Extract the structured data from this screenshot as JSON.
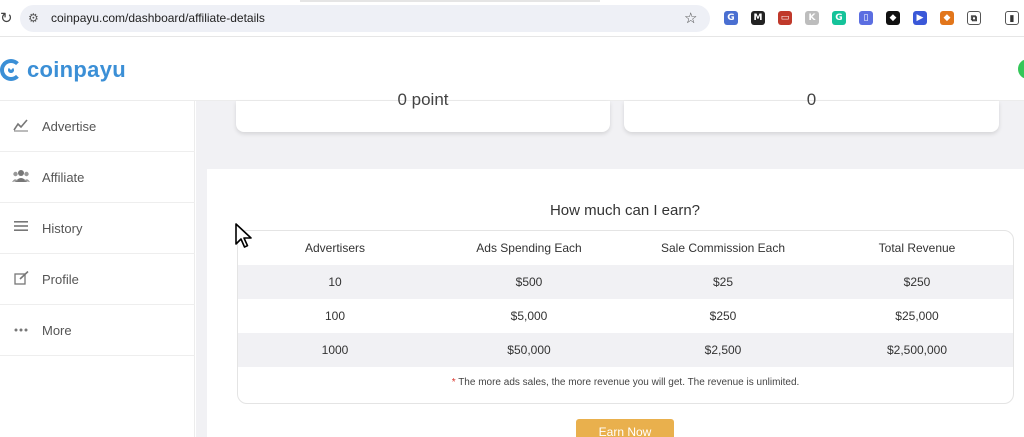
{
  "browser": {
    "url": "coinpayu.com/dashboard/affiliate-details",
    "extensions": [
      {
        "name": "translate-icon",
        "color": "#4a6fd1",
        "glyph": "G"
      },
      {
        "name": "m-extension-icon",
        "color": "#222222",
        "glyph": "M"
      },
      {
        "name": "inbox-extension-icon",
        "color": "#c0392b",
        "glyph": "▭"
      },
      {
        "name": "k-extension-icon",
        "color": "#bdbdbd",
        "glyph": "K"
      },
      {
        "name": "grammarly-icon",
        "color": "#15c39a",
        "glyph": "G"
      },
      {
        "name": "screen-extension-icon",
        "color": "#5b6ee1",
        "glyph": "▯"
      },
      {
        "name": "drop-extension-icon",
        "color": "#111111",
        "glyph": "◆"
      },
      {
        "name": "play-extension-icon",
        "color": "#3a58d8",
        "glyph": "▶"
      },
      {
        "name": "metamask-icon",
        "color": "#e2761b",
        "glyph": "◆"
      },
      {
        "name": "extensions-puzzle-icon",
        "color": "#ffffff",
        "glyph": "⧉"
      },
      {
        "name": "side-panel-icon",
        "color": "#ffffff",
        "glyph": "▮"
      }
    ]
  },
  "header": {
    "logo_text": "coinpayu",
    "brand_color": "#3b8fd6"
  },
  "sidebar": {
    "items": [
      {
        "label": "Advertise",
        "icon": "chart-line-icon"
      },
      {
        "label": "Affiliate",
        "icon": "users-icon"
      },
      {
        "label": "History",
        "icon": "list-icon"
      },
      {
        "label": "Profile",
        "icon": "edit-icon"
      },
      {
        "label": "More",
        "icon": "ellipsis-icon"
      }
    ]
  },
  "stats": {
    "left_value": "0 point",
    "right_value": "0"
  },
  "earnings": {
    "title": "How much can I earn?",
    "headers": [
      "Advertisers",
      "Ads Spending Each",
      "Sale Commission Each",
      "Total Revenue"
    ],
    "rows": [
      [
        "10",
        "$500",
        "$25",
        "$250"
      ],
      [
        "100",
        "$5,000",
        "$250",
        "$25,000"
      ],
      [
        "1000",
        "$50,000",
        "$2,500",
        "$2,500,000"
      ]
    ],
    "note_marker": "*",
    "note": "The more ads sales, the more revenue you will get. The revenue is unlimited.",
    "button_label": "Earn Now",
    "button_color": "#e9b04d"
  }
}
